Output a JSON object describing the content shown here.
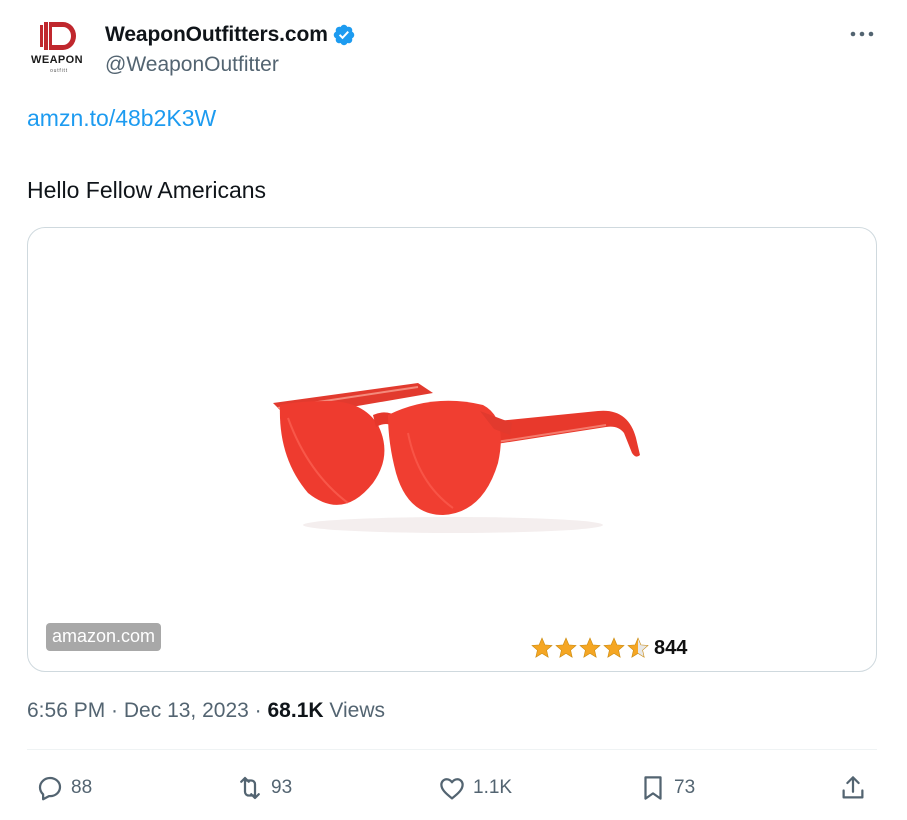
{
  "author": {
    "display_name": "WeaponOutfitters.com",
    "handle": "@WeaponOutfitter",
    "avatar_text": "WEAPON",
    "avatar_subtext": "outfitt",
    "verified": true,
    "verified_color": "#1d9bf0"
  },
  "tweet": {
    "link": "amzn.to/48b2K3W",
    "text": "Hello Fellow Americans"
  },
  "card": {
    "domain": "amazon.com",
    "rating_stars": 4.5,
    "rating_count": "844",
    "image_icon": "red-sunglasses"
  },
  "meta": {
    "time": "6:56 PM",
    "separator": " · ",
    "date": "Dec 13, 2023",
    "views_count": "68.1K",
    "views_label": " Views"
  },
  "actions": {
    "replies": "88",
    "reposts": "93",
    "likes": "1.1K",
    "bookmarks": "73"
  },
  "colors": {
    "link": "#1d9bf0",
    "secondary_text": "#536471",
    "primary_text": "#0f1419",
    "brand_red": "#c0272d",
    "star": "#f5a623"
  }
}
